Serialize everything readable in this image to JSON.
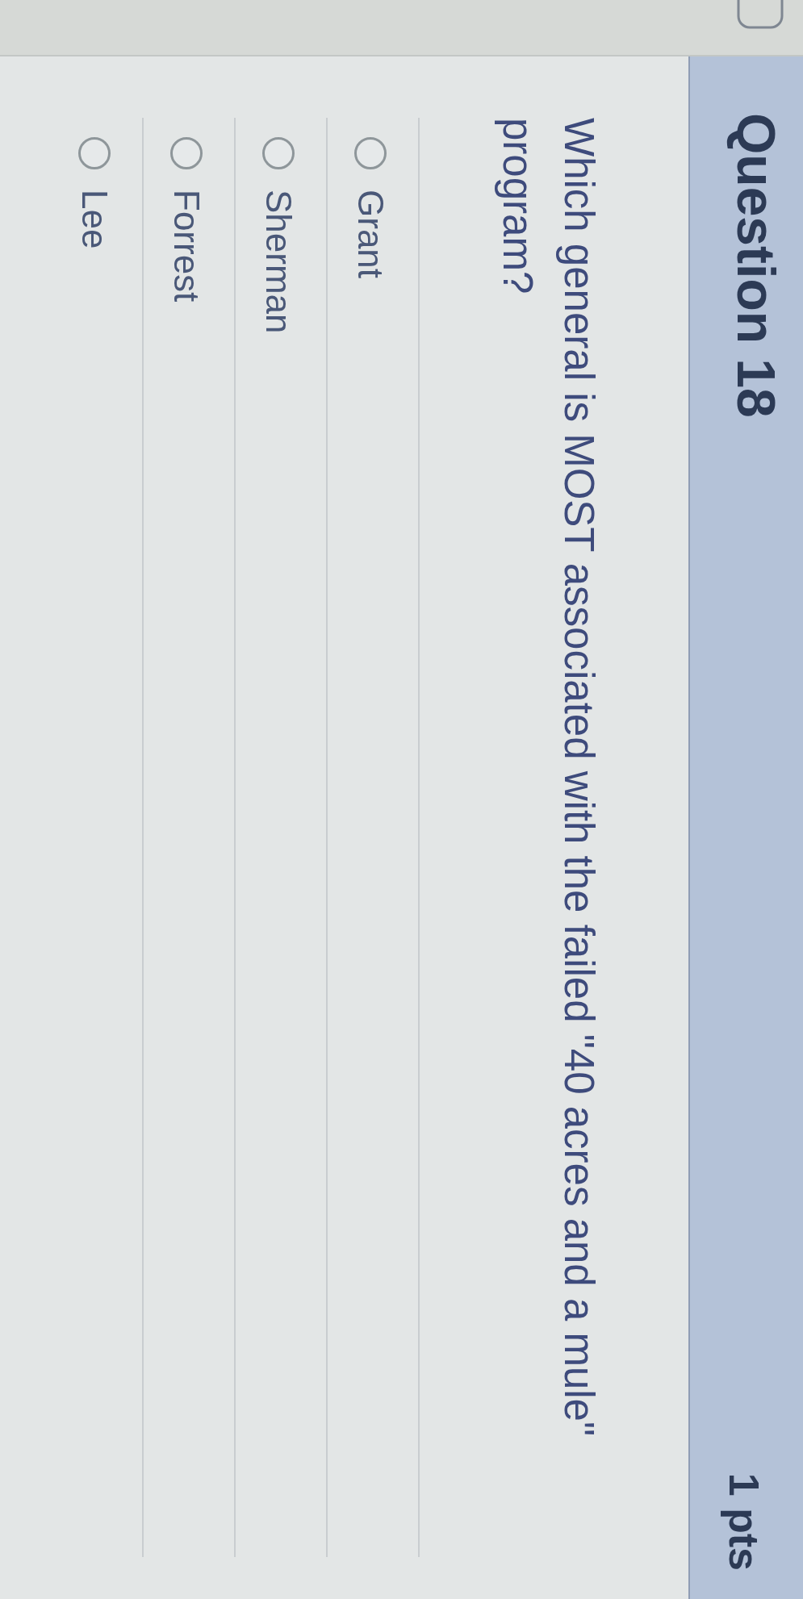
{
  "question": {
    "title": "Question 18",
    "points": "1 pts",
    "text": "Which general is MOST associated with the failed \"40 acres and a mule\" program?"
  },
  "answers": [
    {
      "label": "Grant",
      "selected": false
    },
    {
      "label": "Sherman",
      "selected": false
    },
    {
      "label": "Forrest",
      "selected": false
    },
    {
      "label": "Lee",
      "selected": false
    }
  ]
}
